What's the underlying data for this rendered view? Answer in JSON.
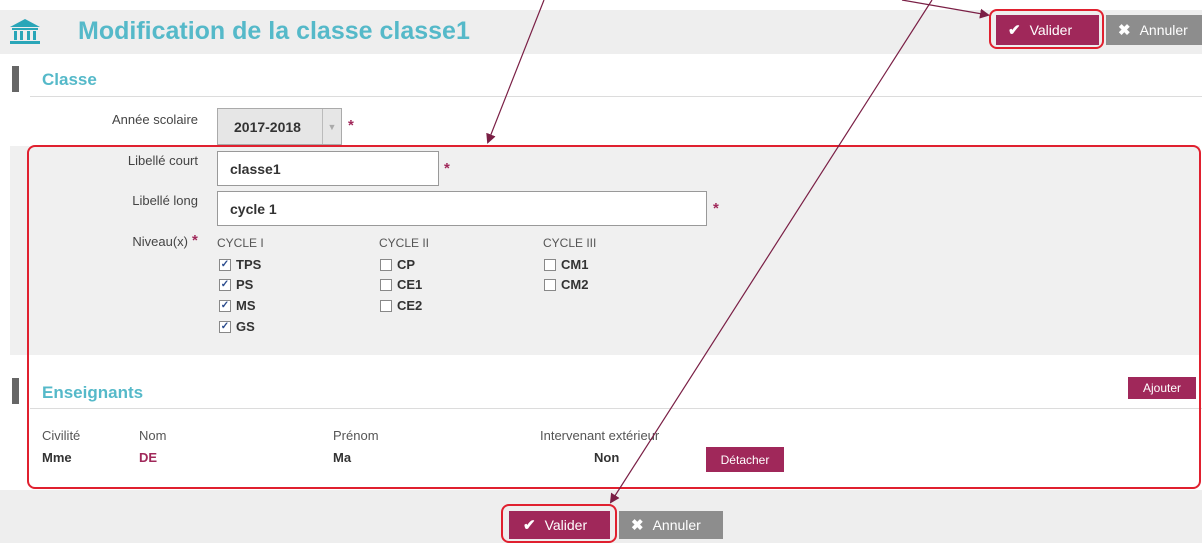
{
  "header": {
    "title": "Modification de la classe classe1"
  },
  "actions": {
    "validate_label": "Valider",
    "cancel_label": "Annuler"
  },
  "classe": {
    "section_title": "Classe",
    "annee": {
      "label": "Année scolaire",
      "value": "2017-2018"
    },
    "libelle_court": {
      "label": "Libellé court",
      "value": "classe1"
    },
    "libelle_long": {
      "label": "Libellé long",
      "value": "cycle 1"
    },
    "niveaux": {
      "label": "Niveau(x)",
      "cycles": [
        {
          "name": "CYCLE I",
          "items": [
            {
              "label": "TPS",
              "checked": true
            },
            {
              "label": "PS",
              "checked": true
            },
            {
              "label": "MS",
              "checked": true
            },
            {
              "label": "GS",
              "checked": true
            }
          ]
        },
        {
          "name": "CYCLE II",
          "items": [
            {
              "label": "CP",
              "checked": false
            },
            {
              "label": "CE1",
              "checked": false
            },
            {
              "label": "CE2",
              "checked": false
            }
          ]
        },
        {
          "name": "CYCLE III",
          "items": [
            {
              "label": "CM1",
              "checked": false
            },
            {
              "label": "CM2",
              "checked": false
            }
          ]
        }
      ]
    }
  },
  "enseignants": {
    "section_title": "Enseignants",
    "add_label": "Ajouter",
    "columns": [
      "Civilité",
      "Nom",
      "Prénom",
      "Intervenant extérieur"
    ],
    "rows": [
      {
        "civilite": "Mme",
        "nom": "DE",
        "prenom": "Ma",
        "intervenant": "Non",
        "detach_label": "Détacher"
      }
    ]
  },
  "colors": {
    "accent": "#a0285a",
    "title": "#55b9c9",
    "highlight": "#e0202f",
    "arrow": "#7a1f45"
  }
}
